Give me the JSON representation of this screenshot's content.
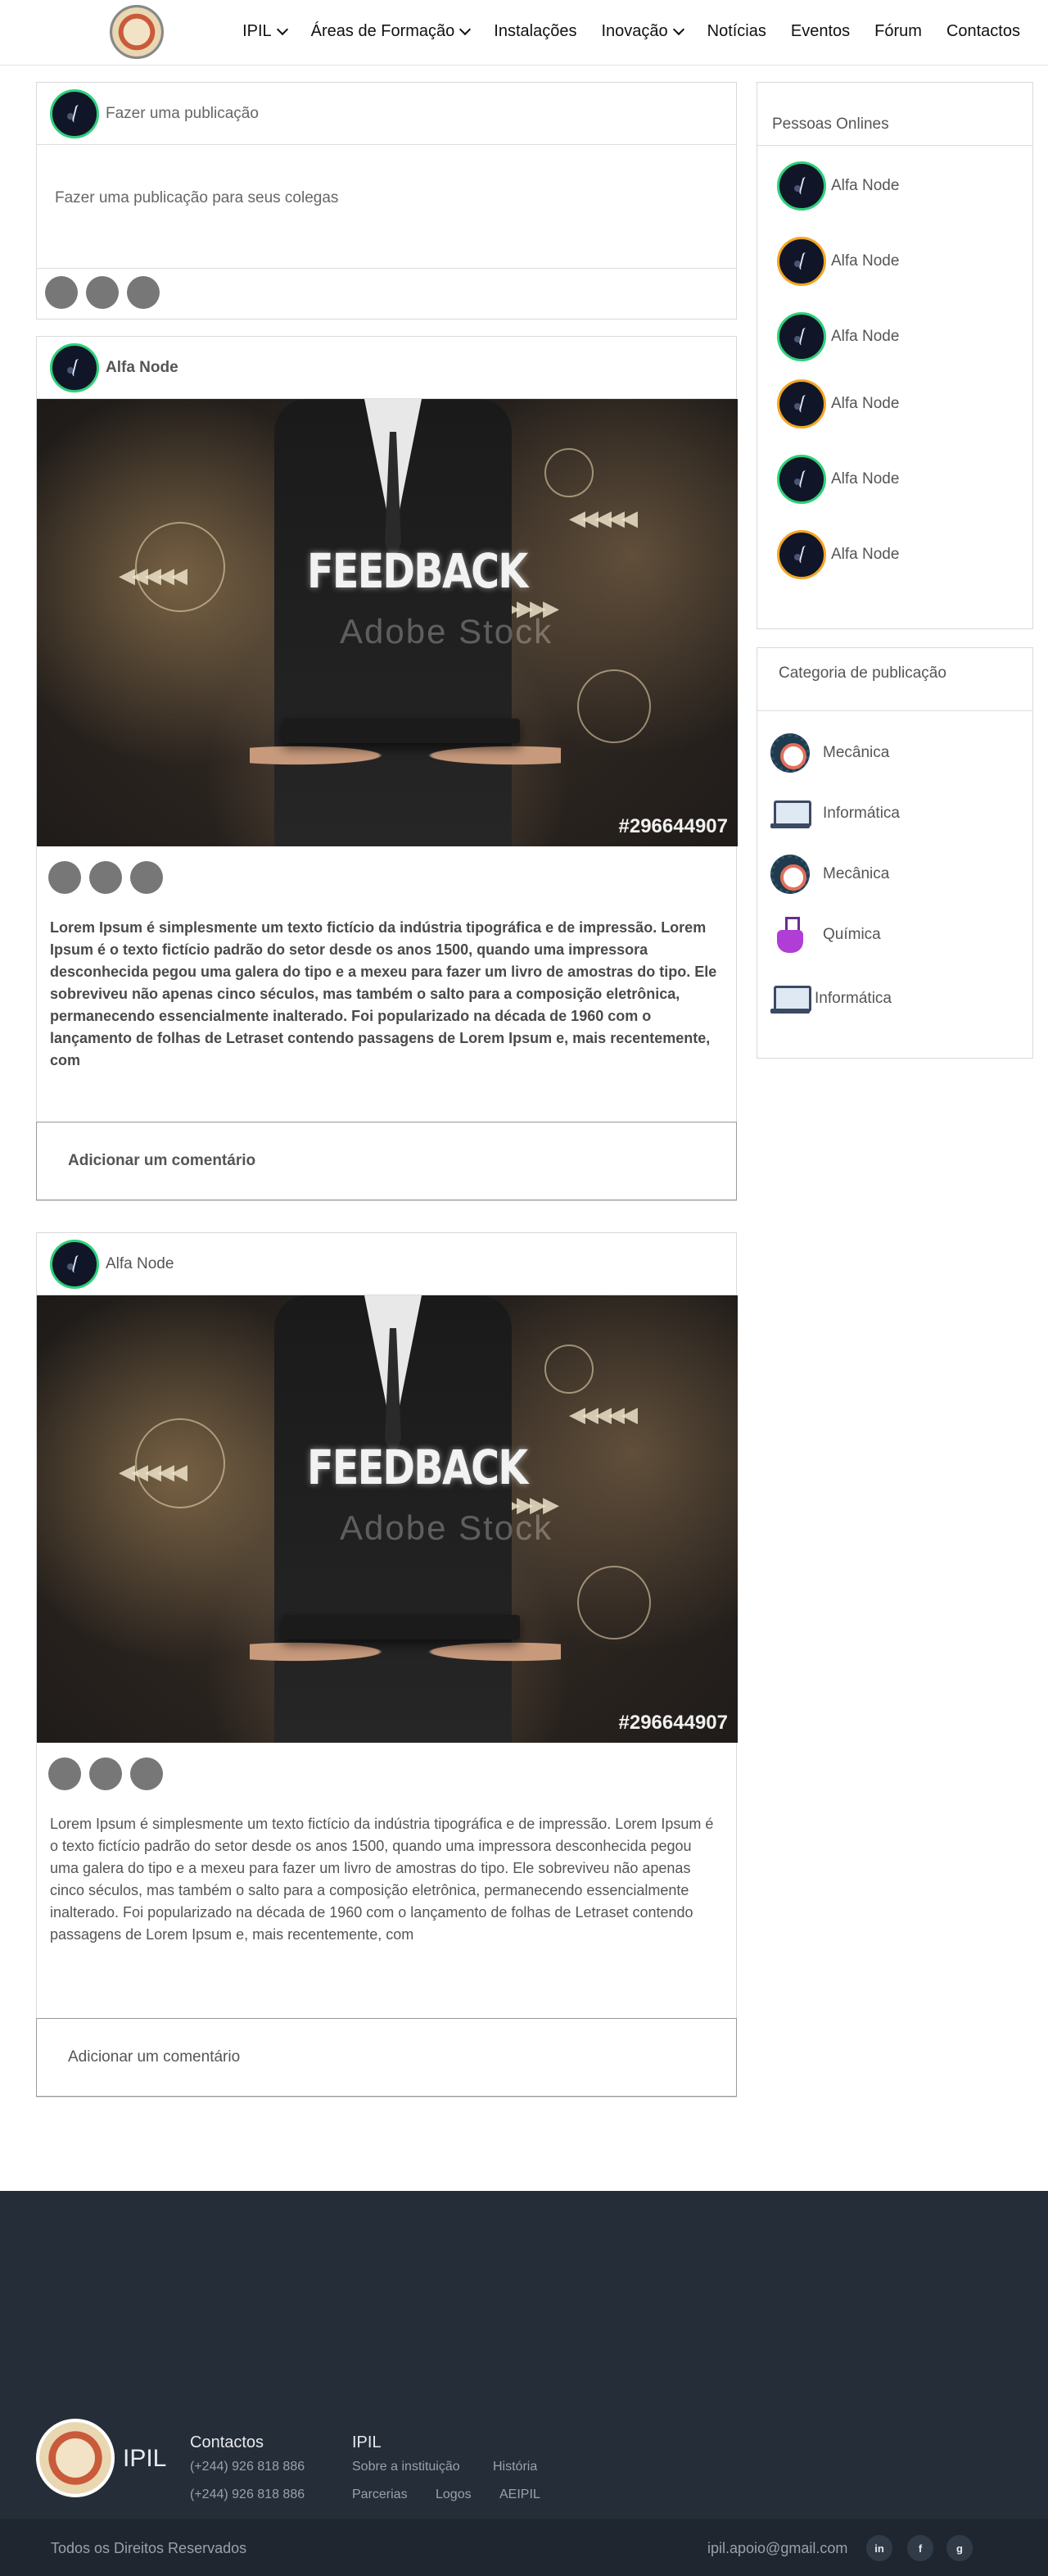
{
  "header": {
    "nav": [
      {
        "label": "IPIL",
        "dropdown": true
      },
      {
        "label": "Áreas de Formação",
        "dropdown": true
      },
      {
        "label": "Instalações",
        "dropdown": false
      },
      {
        "label": "Inovação",
        "dropdown": true
      },
      {
        "label": "Notícias",
        "dropdown": false
      },
      {
        "label": "Eventos",
        "dropdown": false
      },
      {
        "label": "Fórum",
        "dropdown": false
      },
      {
        "label": "Contactos",
        "dropdown": false
      }
    ]
  },
  "composer": {
    "title": "Fazer uma publicação",
    "placeholder": "Fazer uma publicação para seus colegas"
  },
  "posts": [
    {
      "author": "Alfa Node",
      "image_heading": "FEEDBACK",
      "image_watermark": "Adobe Stock",
      "image_id": "#296644907",
      "body": "Lorem Ipsum é simplesmente um texto fictício da indústria tipográfica e de impressão. Lorem Ipsum é o texto fictício padrão do setor desde os anos 1500, quando uma impressora desconhecida pegou uma galera do tipo e a mexeu para fazer um livro de amostras do tipo. Ele sobreviveu não apenas cinco séculos, mas também o salto para a composição eletrônica, permanecendo essencialmente inalterado. Foi popularizado na década de 1960 com o lançamento de folhas de Letraset contendo passagens de Lorem Ipsum e, mais recentemente, com",
      "comment_placeholder": "Adicionar um comentário"
    },
    {
      "author": "Alfa Node",
      "image_heading": "FEEDBACK",
      "image_watermark": "Adobe Stock",
      "image_id": "#296644907",
      "body": "Lorem Ipsum é simplesmente um texto fictício da indústria tipográfica e de impressão. Lorem Ipsum é o texto fictício padrão do setor desde os anos 1500, quando uma impressora desconhecida pegou uma galera do tipo e a mexeu para fazer um livro de amostras do tipo. Ele sobreviveu não apenas cinco séculos, mas também o salto para a composição eletrônica, permanecendo essencialmente inalterado. Foi popularizado na década de 1960 com o lançamento de folhas de Letraset contendo passagens de Lorem Ipsum e, mais recentemente, com",
      "comment_placeholder": "Adicionar um comentário"
    }
  ],
  "online": {
    "title": "Pessoas Onlines",
    "people": [
      {
        "name": "Alfa Node",
        "ring_color": "#2fd07a"
      },
      {
        "name": "Alfa Node",
        "ring_color": "#f5a623"
      },
      {
        "name": "Alfa Node",
        "ring_color": "#2fd07a"
      },
      {
        "name": "Alfa Node",
        "ring_color": "#f5a623"
      },
      {
        "name": "Alfa Node",
        "ring_color": "#2fd07a"
      },
      {
        "name": "Alfa Node",
        "ring_color": "#f5a623"
      }
    ]
  },
  "categories": {
    "title": "Categoria de publicação",
    "items": [
      {
        "name": "Mecânica",
        "icon": "gear-icon"
      },
      {
        "name": "Informática",
        "icon": "laptop-icon"
      },
      {
        "name": "Mecânica",
        "icon": "gear-icon"
      },
      {
        "name": "Química",
        "icon": "flask-icon"
      },
      {
        "name": "Informática",
        "icon": "laptop-icon"
      }
    ]
  },
  "footer": {
    "brand": "IPIL",
    "contacts_title": "Contactos",
    "phones": [
      "(+244) 926 818 886",
      "(+244) 926 818 886"
    ],
    "ipil_title": "IPIL",
    "links": [
      "Sobre a instituição",
      "História",
      "Parcerias",
      "Logos",
      "AEIPIL"
    ],
    "copyright": "Todos os Direitos Reservados",
    "email": "ipil.apoio@gmail.com",
    "social": [
      "in",
      "f",
      "g"
    ]
  }
}
